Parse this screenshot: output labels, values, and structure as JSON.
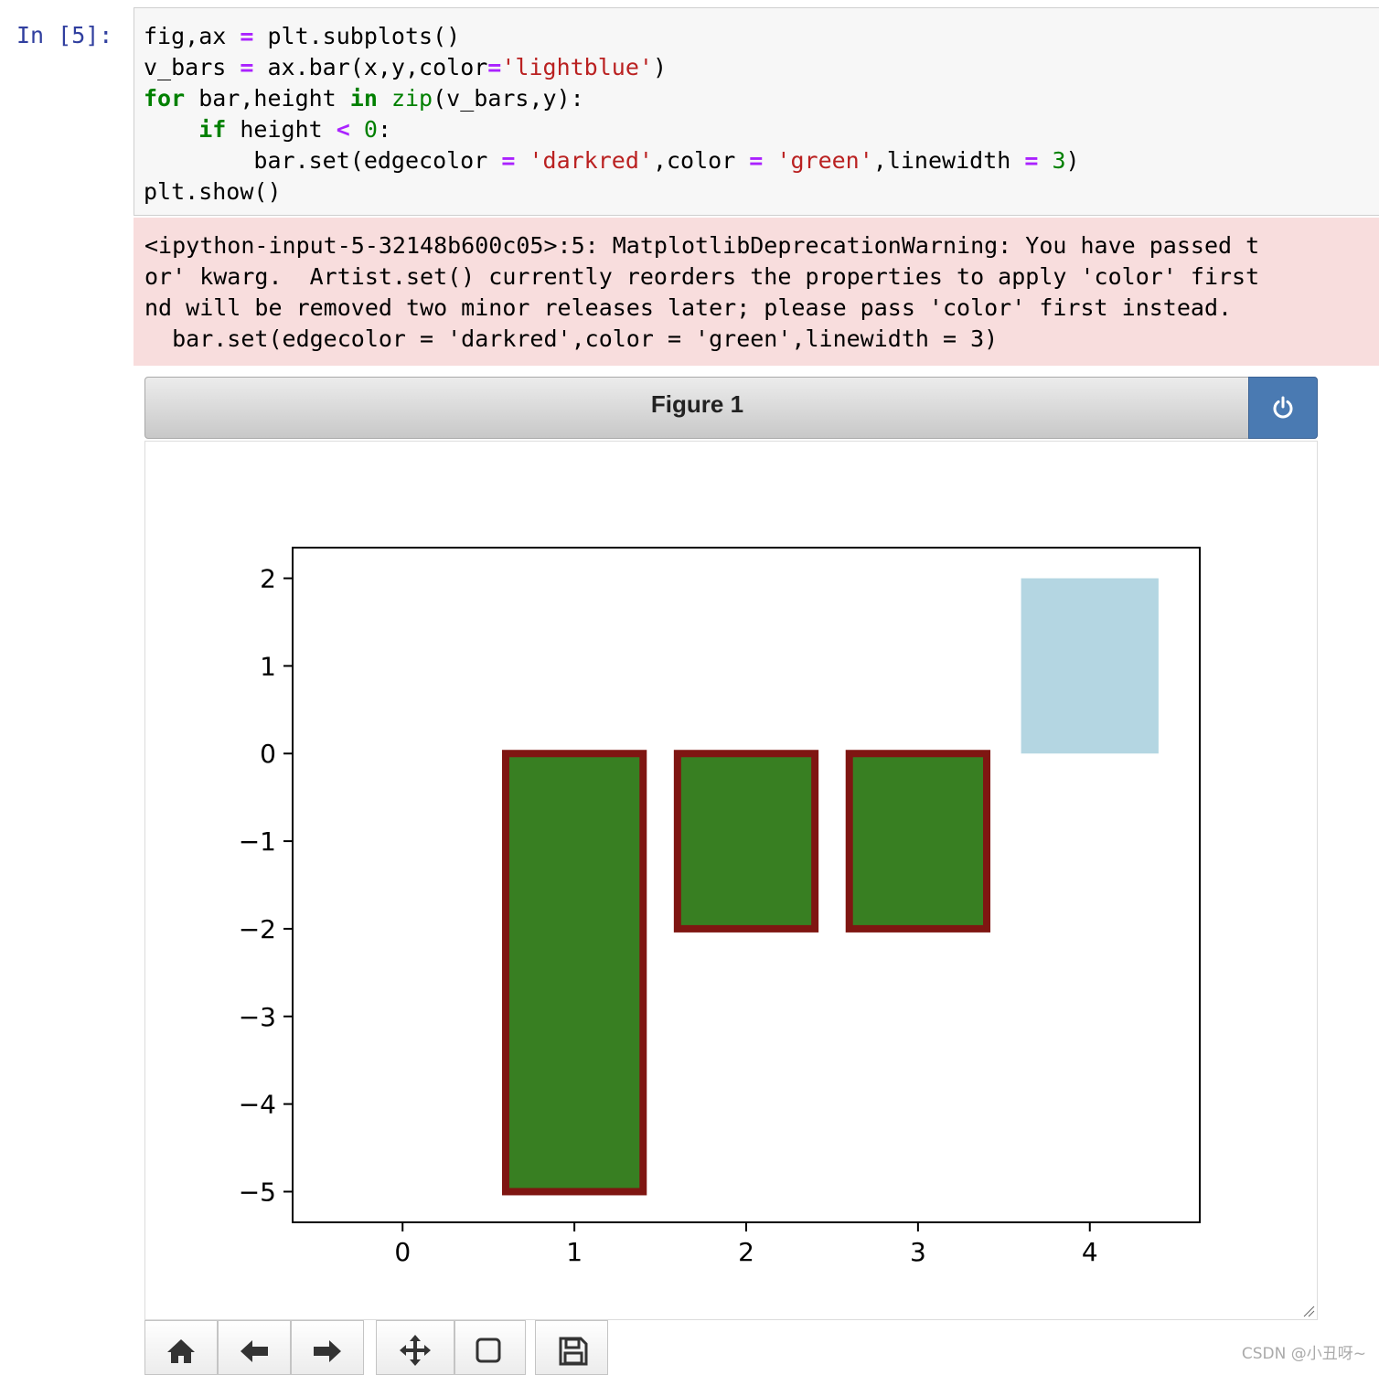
{
  "cell": {
    "prompt": "In [5]:",
    "code_lines": [
      "fig,ax = plt.subplots()",
      "v_bars = ax.bar(x,y,color='lightblue')",
      "for bar,height in zip(v_bars,y):",
      "    if height < 0:",
      "        bar.set(edgecolor = 'darkred',color = 'green',linewidth = 3)",
      "plt.show()"
    ]
  },
  "warning": {
    "lines": [
      "<ipython-input-5-32148b600c05>:5: MatplotlibDeprecationWarning: You have passed t",
      "or' kwarg.  Artist.set() currently reorders the properties to apply 'color' first",
      "nd will be removed two minor releases later; please pass 'color' first instead.",
      "  bar.set(edgecolor = 'darkred',color = 'green',linewidth = 3)"
    ]
  },
  "figure": {
    "title": "Figure 1",
    "power_icon": "power-icon"
  },
  "chart_data": {
    "type": "bar",
    "categories": [
      0,
      1,
      2,
      3,
      4
    ],
    "values": [
      0,
      -5,
      -2,
      -2,
      2
    ],
    "bar_colors": [
      "#add8e6",
      "#008000",
      "#008000",
      "#008000",
      "#add8e6"
    ],
    "edge_colors": [
      "none",
      "#8b0000",
      "#8b0000",
      "#8b0000",
      "none"
    ],
    "xticks": [
      "0",
      "1",
      "2",
      "3",
      "4"
    ],
    "yticks": [
      "2",
      "1",
      "0",
      "−1",
      "−2",
      "−3",
      "−4",
      "−5"
    ],
    "xlim": [
      -0.64,
      4.64
    ],
    "ylim": [
      -5.35,
      2.35
    ],
    "title": "",
    "xlabel": "",
    "ylabel": "",
    "grid": false
  },
  "toolbar": {
    "buttons": [
      "home-icon",
      "back-arrow-icon",
      "forward-arrow-icon",
      "pan-icon",
      "zoom-rect-icon",
      "save-icon"
    ]
  },
  "watermark": "CSDN @小丑呀~"
}
